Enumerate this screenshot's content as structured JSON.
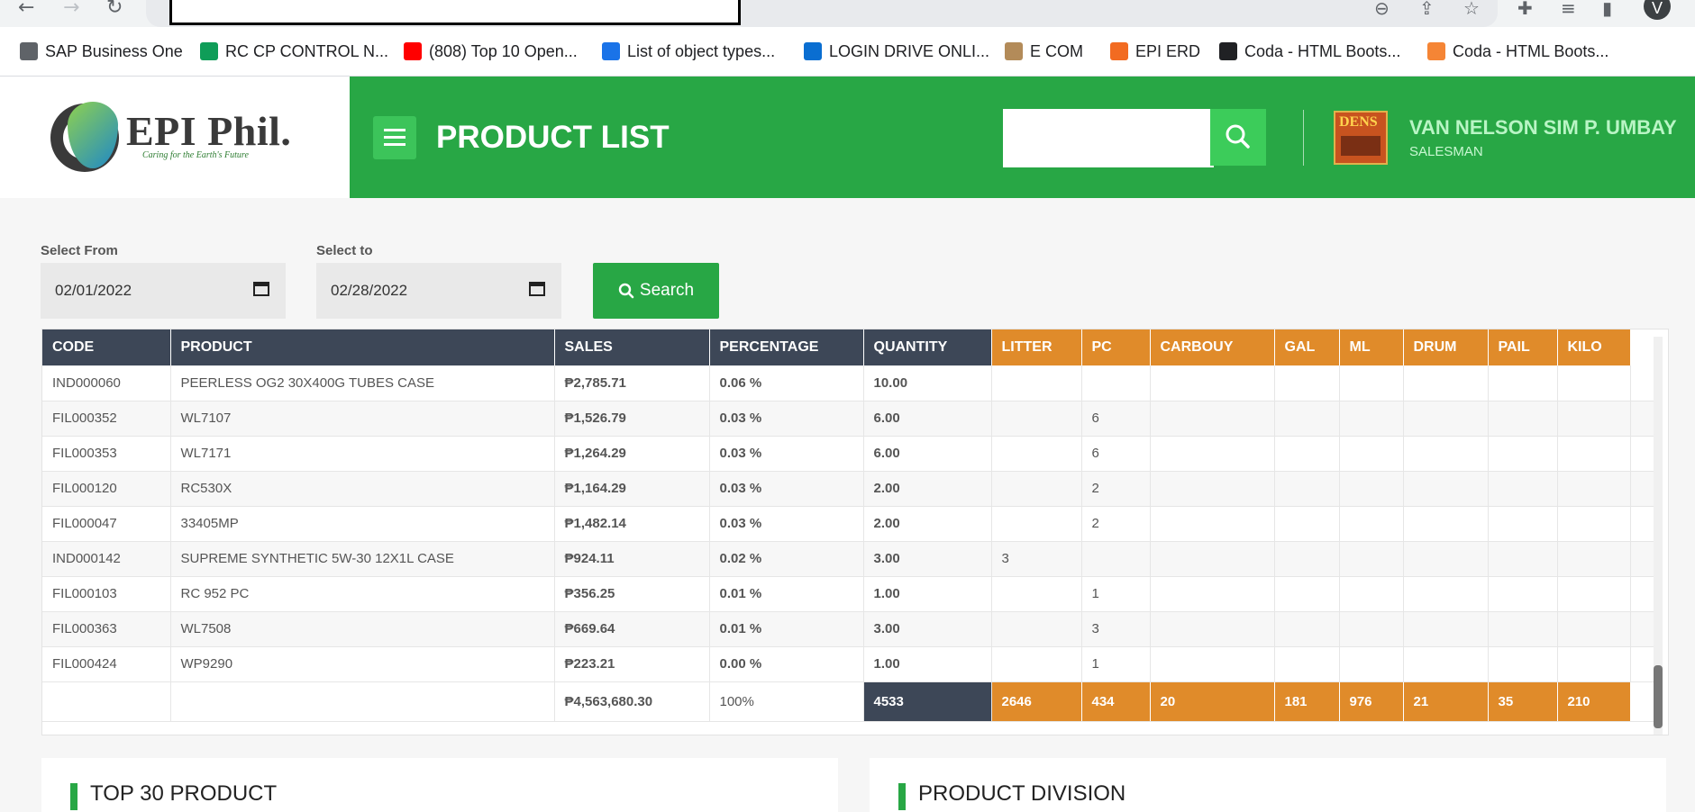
{
  "browser": {
    "back_icon": "arrow-left-icon",
    "forward_icon": "arrow-right-icon",
    "reload_icon": "reload-icon",
    "profile_initial": "V",
    "bookmarks": [
      {
        "label": "SAP Business One",
        "icon": "globe-icon",
        "color": "#5f6368"
      },
      {
        "label": "RC CP CONTROL N...",
        "icon": "sheets-icon",
        "color": "#0f9d58"
      },
      {
        "label": "(808) Top 10 Open...",
        "icon": "youtube-icon",
        "color": "#ff0000"
      },
      {
        "label": "List of object types...",
        "icon": "sap-icon",
        "color": "#1a73e8"
      },
      {
        "label": "LOGIN DRIVE ONLI...",
        "icon": "cloud-icon",
        "color": "#0a6ed1"
      },
      {
        "label": "E COM",
        "icon": "ecom-icon",
        "color": "#b38b59"
      },
      {
        "label": "EPI ERD",
        "icon": "erd-icon",
        "color": "#f26b21"
      },
      {
        "label": "Coda - HTML Boots...",
        "icon": "coda-w-icon",
        "color": "#202124"
      },
      {
        "label": "Coda - HTML Boots...",
        "icon": "coda-icon",
        "color": "#f58535"
      }
    ]
  },
  "header": {
    "logo_text": "EPI Phil.",
    "logo_tagline": "Caring for the Earth's Future",
    "title": "PRODUCT LIST",
    "search_value": "",
    "user_avatar_text": "DENS",
    "user_name": "VAN NELSON SIM P. UMBAY",
    "user_role": "SALESMAN",
    "brand_color": "#28a745"
  },
  "filters": {
    "from_label": "Select From",
    "from_value": "02/01/2022",
    "to_label": "Select to",
    "to_value": "02/28/2022",
    "search_label": "Search"
  },
  "table": {
    "columns": [
      "CODE",
      "PRODUCT",
      "SALES",
      "PERCENTAGE",
      "QUANTITY",
      "LITTER",
      "PC",
      "CARBOUY",
      "GAL",
      "ML",
      "DRUM",
      "PAIL",
      "KILO"
    ],
    "rows": [
      [
        "IND000060",
        "PEERLESS OG2 30X400G TUBES CASE",
        "₱2,785.71",
        "0.06 %",
        "10.00",
        "",
        "",
        "",
        "",
        "",
        "",
        "",
        ""
      ],
      [
        "FIL000352",
        "WL7107",
        "₱1,526.79",
        "0.03 %",
        "6.00",
        "",
        "6",
        "",
        "",
        "",
        "",
        "",
        ""
      ],
      [
        "FIL000353",
        "WL7171",
        "₱1,264.29",
        "0.03 %",
        "6.00",
        "",
        "6",
        "",
        "",
        "",
        "",
        "",
        ""
      ],
      [
        "FIL000120",
        "RC530X",
        "₱1,164.29",
        "0.03 %",
        "2.00",
        "",
        "2",
        "",
        "",
        "",
        "",
        "",
        ""
      ],
      [
        "FIL000047",
        "33405MP",
        "₱1,482.14",
        "0.03 %",
        "2.00",
        "",
        "2",
        "",
        "",
        "",
        "",
        "",
        ""
      ],
      [
        "IND000142",
        "SUPREME SYNTHETIC 5W-30 12X1L CASE",
        "₱924.11",
        "0.02 %",
        "3.00",
        "3",
        "",
        "",
        "",
        "",
        "",
        "",
        ""
      ],
      [
        "FIL000103",
        "RC 952 PC",
        "₱356.25",
        "0.01 %",
        "1.00",
        "",
        "1",
        "",
        "",
        "",
        "",
        "",
        ""
      ],
      [
        "FIL000363",
        "WL7508",
        "₱669.64",
        "0.01 %",
        "3.00",
        "",
        "3",
        "",
        "",
        "",
        "",
        "",
        ""
      ],
      [
        "FIL000424",
        "WP9290",
        "₱223.21",
        "0.00 %",
        "1.00",
        "",
        "1",
        "",
        "",
        "",
        "",
        "",
        ""
      ]
    ],
    "totals": {
      "sales": "₱4,563,680.30",
      "percentage": "100%",
      "quantity": "4533",
      "litter": "2646",
      "pc": "434",
      "carbouy": "20",
      "gal": "181",
      "ml": "976",
      "drum": "21",
      "pail": "35",
      "kilo": "210"
    }
  },
  "cards": {
    "left_title": "TOP 30 PRODUCT",
    "right_title": "PRODUCT DIVISION"
  }
}
